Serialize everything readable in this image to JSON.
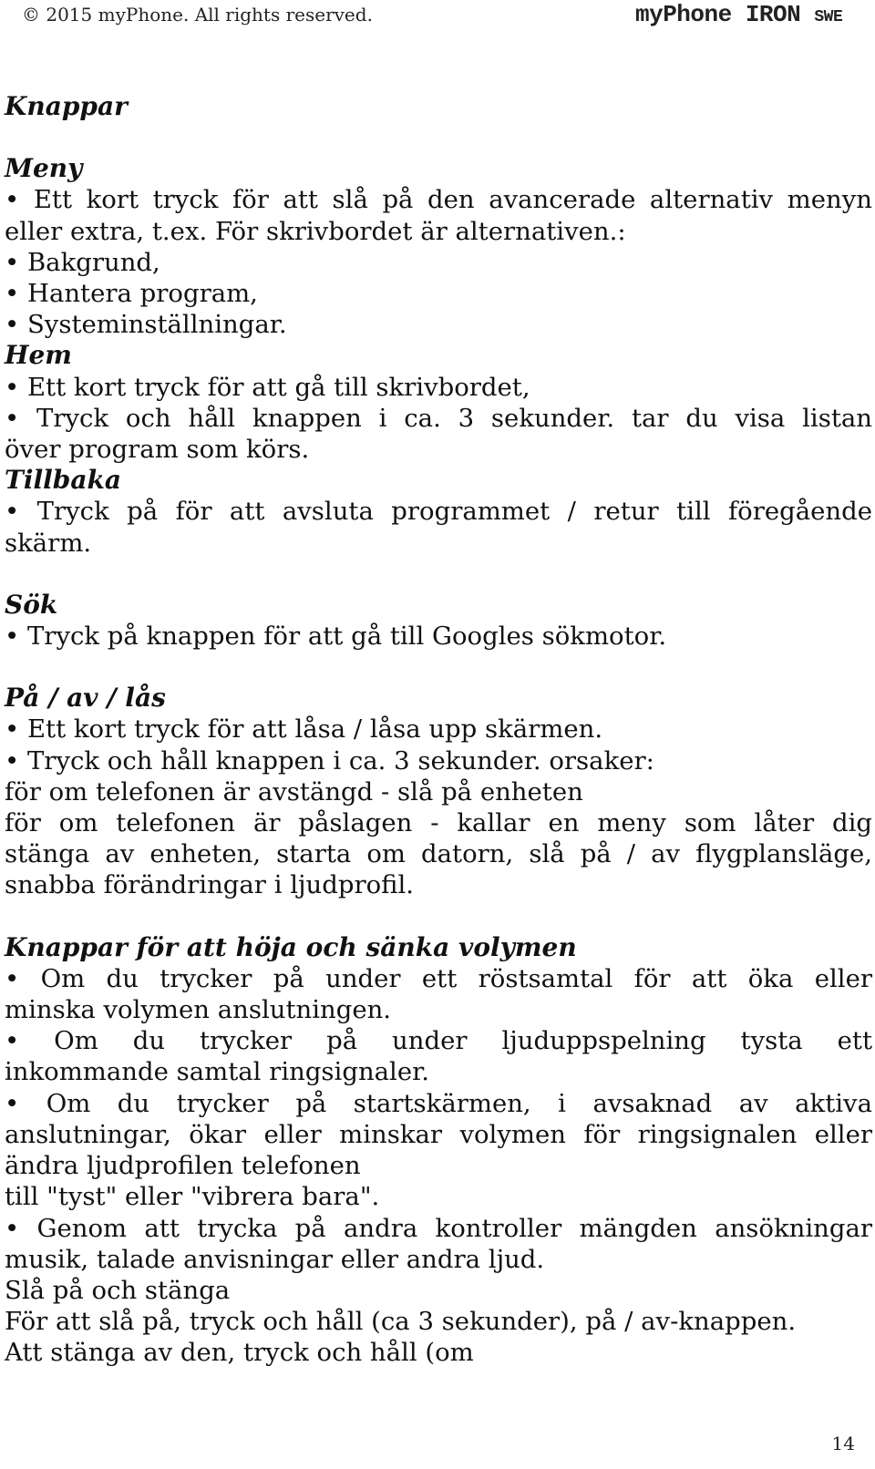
{
  "header": {
    "copyright": "© 2015 myPhone. All rights reserved.",
    "brand": "myPhone IRON",
    "brand_suffix": "SWE"
  },
  "sections": {
    "knappar": {
      "title": "Knappar"
    },
    "meny": {
      "title": "Meny",
      "lines": [
        "• Ett kort tryck för att slå på den avancerade alternativ menyn",
        "eller extra, t.ex. För skrivbordet är alternativen.:",
        "• Bakgrund,",
        "• Hantera program,",
        "• Systeminställningar."
      ]
    },
    "hem": {
      "title": "Hem",
      "lines": [
        "• Ett kort tryck för att gå till skrivbordet,",
        "• Tryck och håll knappen i ca. 3 sekunder. tar du visa listan",
        "över program som körs."
      ]
    },
    "tillbaka": {
      "title": "Tillbaka",
      "lines": [
        "• Tryck på för att avsluta programmet / retur till föregående",
        "skärm."
      ]
    },
    "sok": {
      "title": "Sök",
      "lines": [
        "• Tryck på knappen för att gå till Googles sökmotor."
      ]
    },
    "pa_av_las": {
      "title": "På / av / lås",
      "lines": [
        "• Ett kort tryck för att låsa / låsa upp skärmen.",
        "• Tryck och håll knappen i ca. 3 sekunder. orsaker:",
        "för om telefonen är avstängd - slå på enheten",
        "för om telefonen är påslagen - kallar en meny som låter dig",
        "stänga av enheten, starta om datorn, slå på / av flygplansläge,",
        "snabba förändringar i ljudprofil."
      ]
    },
    "volym": {
      "title": "Knappar för att höja och sänka volymen",
      "lines": [
        "• Om du trycker på under ett röstsamtal för att öka eller",
        "minska volymen anslutningen.",
        "• Om du trycker på under ljuduppspelning tysta ett",
        "inkommande samtal ringsignaler.",
        "• Om du trycker på startskärmen, i avsaknad av aktiva",
        "anslutningar, ökar eller minskar volymen för ringsignalen eller",
        "ändra ljudprofilen telefonen",
        "till \"tyst\" eller \"vibrera bara\".",
        "• Genom att trycka på andra kontroller mängden ansökningar",
        "musik, talade anvisningar eller andra ljud.",
        "Slå på och stänga",
        "För att slå på, tryck och håll (ca 3 sekunder), på / av-knappen.",
        "Att stänga av den, tryck och håll (om"
      ]
    }
  },
  "footer": {
    "page_number": "14"
  }
}
